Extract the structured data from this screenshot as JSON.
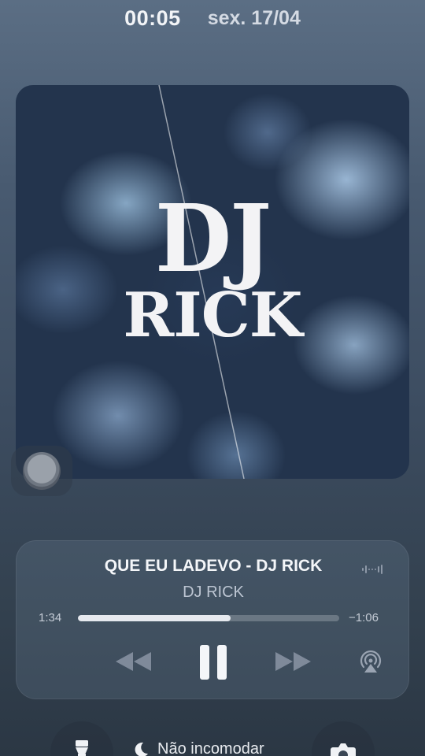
{
  "status_bar": {
    "time": "00:05",
    "date": "sex. 17/04"
  },
  "album": {
    "logo_line1": "DJ",
    "logo_line2": "RICK"
  },
  "player": {
    "title": "QUE EU LADEVO - DJ RICK",
    "artist": "DJ RICK",
    "elapsed": "1:34",
    "remaining": "−1:06",
    "progress_fraction": 0.585,
    "state": "playing",
    "icons": [
      "waveform-icon",
      "rewind-icon",
      "pause-icon",
      "fast-forward-icon",
      "airplay-icon"
    ]
  },
  "bottom_bar": {
    "focus_label": "Não incomodar",
    "icons": [
      "flashlight-icon",
      "moon-icon",
      "camera-icon"
    ]
  },
  "colors": {
    "background_top": "#5b6e84",
    "background_bottom": "#2b3744",
    "progress_fill": "#e6e9ee",
    "album_base": "#23344d"
  }
}
